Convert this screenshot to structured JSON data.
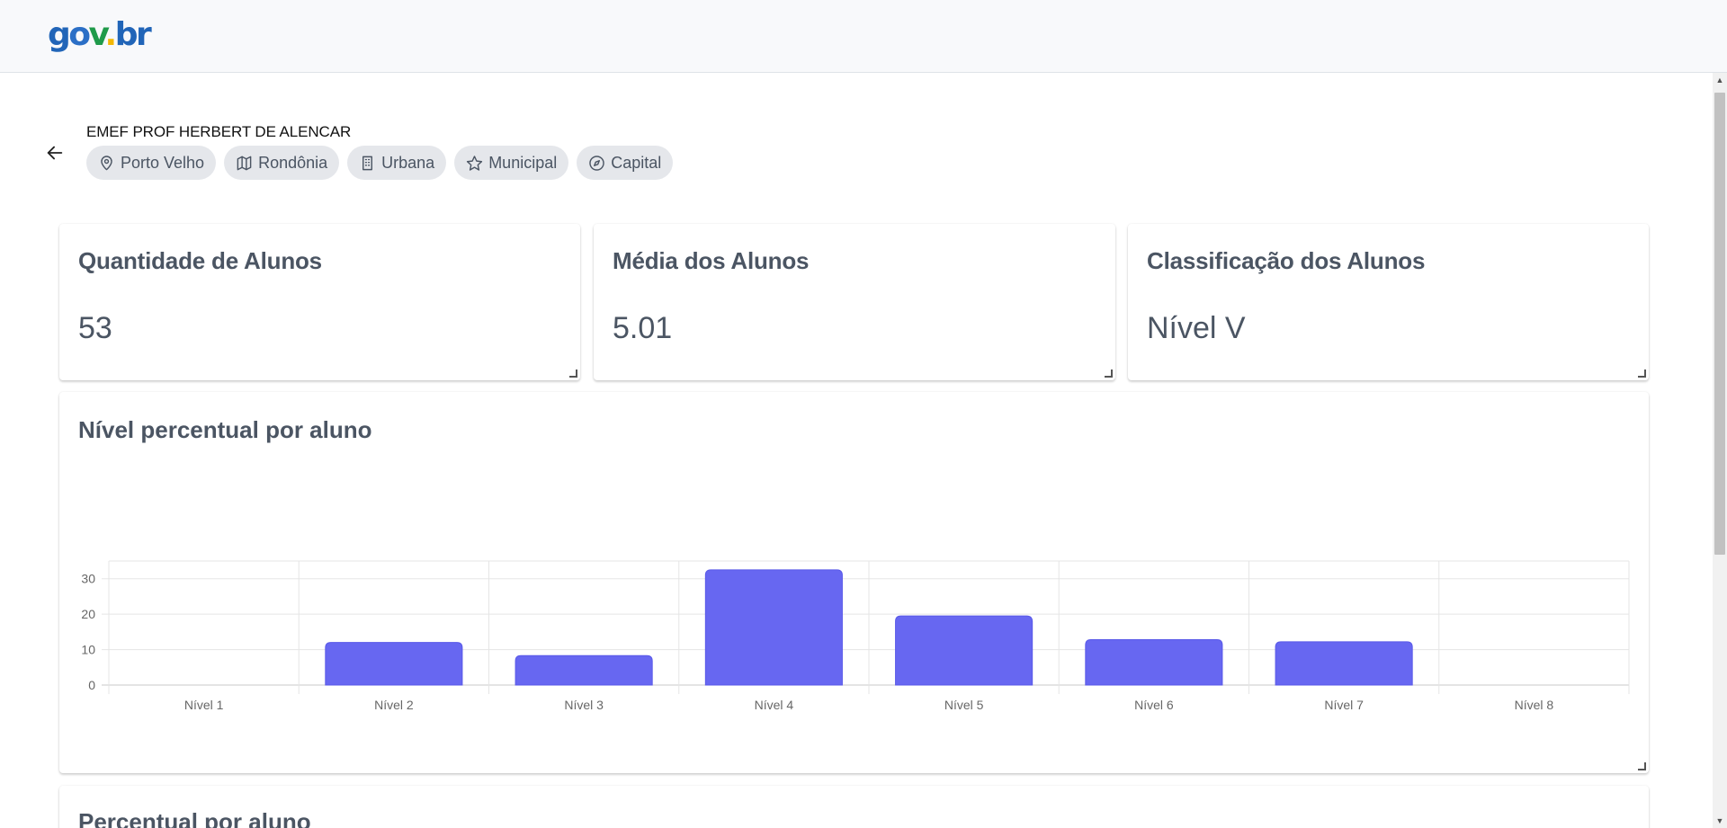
{
  "header": {
    "logo": {
      "g": "g",
      "o": "o",
      "v": "v",
      "dot": ".",
      "br": "br"
    }
  },
  "school": {
    "name": "EMEF PROF HERBERT DE ALENCAR",
    "tags": [
      {
        "icon": "map-pin-icon",
        "label": "Porto Velho"
      },
      {
        "icon": "map-icon",
        "label": "Rondônia"
      },
      {
        "icon": "building-icon",
        "label": "Urbana"
      },
      {
        "icon": "star-icon",
        "label": "Municipal"
      },
      {
        "icon": "compass-icon",
        "label": "Capital"
      }
    ]
  },
  "stats": [
    {
      "title": "Quantidade de Alunos",
      "value": "53"
    },
    {
      "title": "Média dos Alunos",
      "value": "5.01"
    },
    {
      "title": "Classificação dos Alunos",
      "value": "Nível V"
    }
  ],
  "chart_data": {
    "type": "bar",
    "title": "Nível percentual por aluno",
    "categories": [
      "Nível 1",
      "Nível 2",
      "Nível 3",
      "Nível 4",
      "Nível 5",
      "Nível 6",
      "Nível 7",
      "Nível 8"
    ],
    "values": [
      0,
      12,
      8.3,
      32.5,
      19.5,
      12.8,
      12.2,
      0
    ],
    "ylim": [
      0,
      35
    ],
    "yticks": [
      0,
      10,
      20,
      30
    ],
    "grid": true,
    "bar_color": "#6767f1"
  },
  "next_section": {
    "title": "Percentual por aluno"
  }
}
